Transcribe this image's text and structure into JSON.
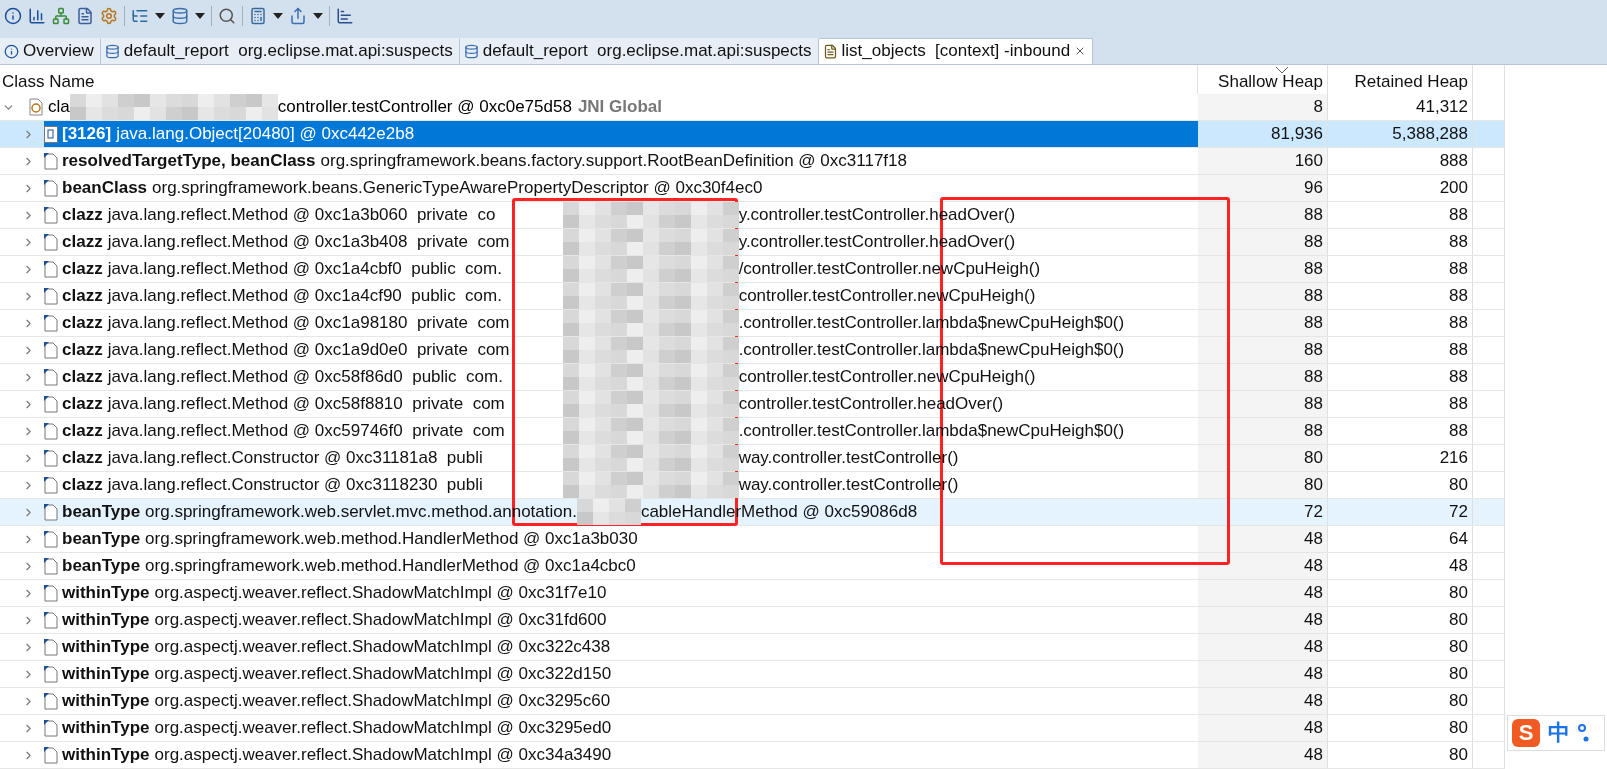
{
  "toolbar": [
    {
      "kind": "info",
      "dropdown": false
    },
    {
      "kind": "histogram",
      "dropdown": false
    },
    {
      "kind": "tree",
      "dropdown": false
    },
    {
      "kind": "query",
      "dropdown": false
    },
    {
      "kind": "gear",
      "dropdown": false
    },
    {
      "kind": "separator"
    },
    {
      "kind": "report",
      "dropdown": true
    },
    {
      "kind": "database",
      "dropdown": true
    },
    {
      "kind": "separator"
    },
    {
      "kind": "search",
      "dropdown": false
    },
    {
      "kind": "separator"
    },
    {
      "kind": "calculator",
      "dropdown": true
    },
    {
      "kind": "export",
      "dropdown": true
    },
    {
      "kind": "separator"
    },
    {
      "kind": "chart",
      "dropdown": false
    }
  ],
  "tabs": [
    {
      "kind": "overview",
      "label": "Overview",
      "selected": false,
      "closable": false
    },
    {
      "kind": "report",
      "label": "default_report  org.eclipse.mat.api:suspects",
      "selected": false,
      "closable": false
    },
    {
      "kind": "report",
      "label": "default_report  org.eclipse.mat.api:suspects",
      "selected": false,
      "closable": false
    },
    {
      "kind": "query",
      "label": "list_objects  [context] -inbound",
      "selected": true,
      "closable": true
    }
  ],
  "columns": [
    "Class Name",
    "Shallow Heap",
    "Retained Heap"
  ],
  "root": {
    "text": "cla",
    "text_after_blur": "controller.testController @ 0xc0e75d58",
    "tag": "JNI Global",
    "shallow": "8",
    "retained": "41,312",
    "expanded": true,
    "children": [
      {
        "kind": "array",
        "field": "[3126]",
        "text": "java.lang.Object[20480] @ 0xc442e2b8",
        "shallow": "81,936",
        "retained": "5,388,288",
        "expanded": false,
        "selected": true,
        "hovered": false
      },
      {
        "kind": "plain",
        "field": "resolvedTargetType, beanClass",
        "text": "org.springframework.beans.factory.support.RootBeanDefinition @ 0xc3117f18",
        "shallow": "160",
        "retained": "888",
        "expanded": false,
        "selected": false,
        "hovered": false
      },
      {
        "kind": "plain",
        "field": "beanClass",
        "text": "org.springframework.beans.GenericTypeAwarePropertyDescriptor @ 0xc30f4ec0",
        "shallow": "96",
        "retained": "200",
        "expanded": false,
        "selected": false,
        "hovered": false
      },
      {
        "kind": "redacted",
        "field": "clazz",
        "text": "java.lang.reflect.Method @ 0xc1a3b060  private  co",
        "text_after_blur": "y.controller.testController.headOver()",
        "shallow": "88",
        "retained": "88",
        "expanded": false,
        "selected": false,
        "hovered": false
      },
      {
        "kind": "redacted",
        "field": "clazz",
        "text": "java.lang.reflect.Method @ 0xc1a3b408  private  com",
        "text_after_blur": "y.controller.testController.headOver()",
        "shallow": "88",
        "retained": "88",
        "expanded": false,
        "selected": false,
        "hovered": false
      },
      {
        "kind": "redacted",
        "field": "clazz",
        "text": "java.lang.reflect.Method @ 0xc1a4cbf0  public  com.",
        "text_after_blur": "/controller.testController.newCpuHeigh()",
        "shallow": "88",
        "retained": "88",
        "expanded": false,
        "selected": false,
        "hovered": false
      },
      {
        "kind": "redacted",
        "field": "clazz",
        "text": "java.lang.reflect.Method @ 0xc1a4cf90  public  com.",
        "text_after_blur": "controller.testController.newCpuHeigh()",
        "shallow": "88",
        "retained": "88",
        "expanded": false,
        "selected": false,
        "hovered": false
      },
      {
        "kind": "redacted",
        "field": "clazz",
        "text": "java.lang.reflect.Method @ 0xc1a98180  private  com",
        "text_after_blur": ".controller.testController.lambda$newCpuHeigh$0()",
        "shallow": "88",
        "retained": "88",
        "expanded": false,
        "selected": false,
        "hovered": false
      },
      {
        "kind": "redacted",
        "field": "clazz",
        "text": "java.lang.reflect.Method @ 0xc1a9d0e0  private  com",
        "text_after_blur": ".controller.testController.lambda$newCpuHeigh$0()",
        "shallow": "88",
        "retained": "88",
        "expanded": false,
        "selected": false,
        "hovered": false
      },
      {
        "kind": "redacted",
        "field": "clazz",
        "text": "java.lang.reflect.Method @ 0xc58f86d0  public  com.",
        "text_after_blur": "controller.testController.newCpuHeigh()",
        "shallow": "88",
        "retained": "88",
        "expanded": false,
        "selected": false,
        "hovered": false
      },
      {
        "kind": "redacted",
        "field": "clazz",
        "text": "java.lang.reflect.Method @ 0xc58f8810  private  com",
        "text_after_blur": "controller.testController.headOver()",
        "shallow": "88",
        "retained": "88",
        "expanded": false,
        "selected": false,
        "hovered": false
      },
      {
        "kind": "redacted",
        "field": "clazz",
        "text": "java.lang.reflect.Method @ 0xc59746f0  private  com",
        "text_after_blur": ".controller.testController.lambda$newCpuHeigh$0()",
        "shallow": "88",
        "retained": "88",
        "expanded": false,
        "selected": false,
        "hovered": false
      },
      {
        "kind": "redacted",
        "field": "clazz",
        "text": "java.lang.reflect.Constructor @ 0xc31181a8  publi",
        "text_after_blur": "way.controller.testController()",
        "shallow": "80",
        "retained": "216",
        "expanded": false,
        "selected": false,
        "hovered": false
      },
      {
        "kind": "redacted",
        "field": "clazz",
        "text": "java.lang.reflect.Constructor @ 0xc3118230  publi",
        "text_after_blur": "way.controller.testController()",
        "shallow": "80",
        "retained": "80",
        "expanded": false,
        "selected": false,
        "hovered": false
      },
      {
        "kind": "partly-redacted",
        "field": "beanType",
        "text": "org.springframework.web.servlet.mvc.method.annotation.",
        "text_after_blur": "cableHandlerMethod @ 0xc59086d8",
        "shallow": "72",
        "retained": "72",
        "expanded": false,
        "selected": false,
        "hovered": true
      },
      {
        "kind": "plain",
        "field": "beanType",
        "text": "org.springframework.web.method.HandlerMethod @ 0xc1a3b030",
        "shallow": "48",
        "retained": "64",
        "expanded": false,
        "selected": false,
        "hovered": false
      },
      {
        "kind": "plain",
        "field": "beanType",
        "text": "org.springframework.web.method.HandlerMethod @ 0xc1a4cbc0",
        "shallow": "48",
        "retained": "48",
        "expanded": false,
        "selected": false,
        "hovered": false
      },
      {
        "kind": "plain",
        "field": "withinType",
        "text": "org.aspectj.weaver.reflect.ShadowMatchImpl @ 0xc31f7e10",
        "shallow": "48",
        "retained": "80",
        "expanded": false,
        "selected": false,
        "hovered": false
      },
      {
        "kind": "plain",
        "field": "withinType",
        "text": "org.aspectj.weaver.reflect.ShadowMatchImpl @ 0xc31fd600",
        "shallow": "48",
        "retained": "80",
        "expanded": false,
        "selected": false,
        "hovered": false
      },
      {
        "kind": "plain",
        "field": "withinType",
        "text": "org.aspectj.weaver.reflect.ShadowMatchImpl @ 0xc322c438",
        "shallow": "48",
        "retained": "80",
        "expanded": false,
        "selected": false,
        "hovered": false
      },
      {
        "kind": "plain",
        "field": "withinType",
        "text": "org.aspectj.weaver.reflect.ShadowMatchImpl @ 0xc322d150",
        "shallow": "48",
        "retained": "80",
        "expanded": false,
        "selected": false,
        "hovered": false
      },
      {
        "kind": "plain",
        "field": "withinType",
        "text": "org.aspectj.weaver.reflect.ShadowMatchImpl @ 0xc3295c60",
        "shallow": "48",
        "retained": "80",
        "expanded": false,
        "selected": false,
        "hovered": false
      },
      {
        "kind": "plain",
        "field": "withinType",
        "text": "org.aspectj.weaver.reflect.ShadowMatchImpl @ 0xc3295ed0",
        "shallow": "48",
        "retained": "80",
        "expanded": false,
        "selected": false,
        "hovered": false
      },
      {
        "kind": "plain",
        "field": "withinType",
        "text": "org.aspectj.weaver.reflect.ShadowMatchImpl @ 0xc34a3490",
        "shallow": "48",
        "retained": "80",
        "expanded": false,
        "selected": false,
        "hovered": false
      }
    ]
  },
  "ime": {
    "logo": "S",
    "mode": "中"
  }
}
